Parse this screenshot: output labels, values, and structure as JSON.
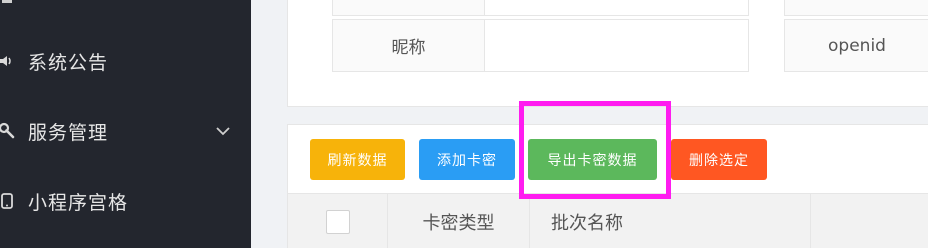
{
  "sidebar": {
    "items": [
      {
        "label": "",
        "icon": "partial-icon"
      },
      {
        "label": "系统公告",
        "icon": "speaker-icon"
      },
      {
        "label": "服务管理",
        "icon": "wrench-icon",
        "has_chevron": true
      },
      {
        "label": "小程序宫格",
        "icon": "mobile-icon"
      }
    ]
  },
  "filters": {
    "nickname_label": "昵称",
    "openid_label": "openid"
  },
  "toolbar": {
    "refresh_label": "刷新数据",
    "add_label": "添加卡密",
    "export_label": "导出卡密数据",
    "delete_label": "删除选定"
  },
  "table": {
    "headers": [
      "卡密类型",
      "批次名称"
    ]
  },
  "colors": {
    "sidebar_bg": "#23262e",
    "refresh": "#f7b30a",
    "add": "#2a9df4",
    "export": "#5cb85c",
    "delete": "#ff5722",
    "highlight": "#ff1cf0"
  }
}
